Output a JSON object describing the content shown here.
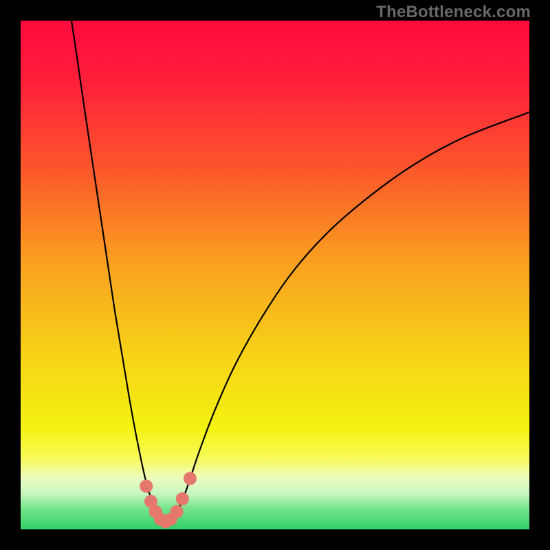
{
  "watermark": "TheBottleneck.com",
  "colors": {
    "frame": "#000000",
    "curve": "#000000",
    "marker_fill": "#e5776d",
    "marker_stroke": "#e5776d",
    "bottom_band": "#33d169"
  },
  "chart_data": {
    "type": "line",
    "title": "",
    "xlabel": "",
    "ylabel": "",
    "xlim": [
      0,
      100
    ],
    "ylim": [
      0,
      100
    ],
    "grid": false,
    "legend": false,
    "gradient_stops": [
      {
        "pos": 0.0,
        "color": "#ff0a3e"
      },
      {
        "pos": 0.12,
        "color": "#ff1f3a"
      },
      {
        "pos": 0.3,
        "color": "#fb5a2a"
      },
      {
        "pos": 0.48,
        "color": "#f9a21f"
      },
      {
        "pos": 0.66,
        "color": "#f7d317"
      },
      {
        "pos": 0.8,
        "color": "#f4f210"
      },
      {
        "pos": 0.86,
        "color": "#f8fb5a"
      },
      {
        "pos": 0.9,
        "color": "#ecfcc0"
      },
      {
        "pos": 0.93,
        "color": "#c7f6c0"
      },
      {
        "pos": 0.96,
        "color": "#72e38a"
      },
      {
        "pos": 1.0,
        "color": "#33d169"
      }
    ],
    "series": [
      {
        "name": "left-branch",
        "type": "line",
        "points": [
          {
            "x": 10.0,
            "y": 100.0
          },
          {
            "x": 11.2,
            "y": 92.0
          },
          {
            "x": 12.5,
            "y": 83.0
          },
          {
            "x": 14.0,
            "y": 73.0
          },
          {
            "x": 15.5,
            "y": 63.0
          },
          {
            "x": 17.0,
            "y": 53.0
          },
          {
            "x": 18.5,
            "y": 43.0
          },
          {
            "x": 20.0,
            "y": 34.0
          },
          {
            "x": 21.5,
            "y": 25.0
          },
          {
            "x": 23.0,
            "y": 17.0
          },
          {
            "x": 24.5,
            "y": 10.0
          },
          {
            "x": 26.0,
            "y": 5.0
          },
          {
            "x": 27.2,
            "y": 2.5
          },
          {
            "x": 28.5,
            "y": 1.5
          }
        ]
      },
      {
        "name": "right-branch",
        "type": "line",
        "points": [
          {
            "x": 28.5,
            "y": 1.5
          },
          {
            "x": 30.0,
            "y": 2.5
          },
          {
            "x": 31.5,
            "y": 5.0
          },
          {
            "x": 33.0,
            "y": 9.0
          },
          {
            "x": 35.0,
            "y": 15.0
          },
          {
            "x": 38.0,
            "y": 23.0
          },
          {
            "x": 42.0,
            "y": 32.0
          },
          {
            "x": 47.0,
            "y": 41.0
          },
          {
            "x": 53.0,
            "y": 50.0
          },
          {
            "x": 60.0,
            "y": 58.0
          },
          {
            "x": 68.0,
            "y": 65.0
          },
          {
            "x": 77.0,
            "y": 71.5
          },
          {
            "x": 87.0,
            "y": 77.0
          },
          {
            "x": 100.0,
            "y": 82.0
          }
        ]
      },
      {
        "name": "valley-markers",
        "type": "scatter",
        "points": [
          {
            "x": 24.7,
            "y": 8.5
          },
          {
            "x": 25.6,
            "y": 5.5
          },
          {
            "x": 26.5,
            "y": 3.5
          },
          {
            "x": 27.5,
            "y": 2.0
          },
          {
            "x": 28.5,
            "y": 1.5
          },
          {
            "x": 29.5,
            "y": 2.0
          },
          {
            "x": 30.7,
            "y": 3.5
          },
          {
            "x": 31.8,
            "y": 6.0
          },
          {
            "x": 33.3,
            "y": 10.0
          }
        ]
      }
    ]
  }
}
